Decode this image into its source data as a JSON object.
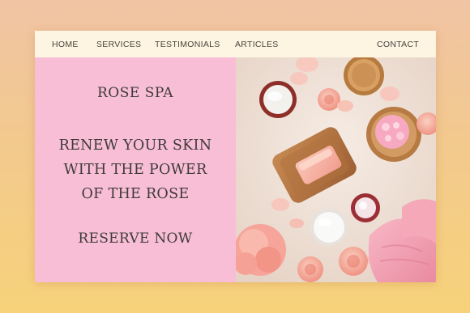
{
  "nav": {
    "home": "HOME",
    "services": "SERVICES",
    "testimonials": "TESTIMONIALS",
    "articles": "ARTICLES",
    "contact": "CONTACT"
  },
  "hero": {
    "brand": "ROSE SPA",
    "headline_lines": [
      "RENEW YOUR SKIN",
      "WITH THE POWER",
      "OF THE ROSE"
    ],
    "cta": "RESERVE NOW"
  },
  "colors": {
    "background_top": "#f1c4a4",
    "background_bottom": "#f7d27a",
    "nav_bg": "#fdf5e1",
    "hero_pink": "#f8bed6",
    "text": "#3e3a37"
  },
  "icons": [
    "spa-products-photo"
  ]
}
